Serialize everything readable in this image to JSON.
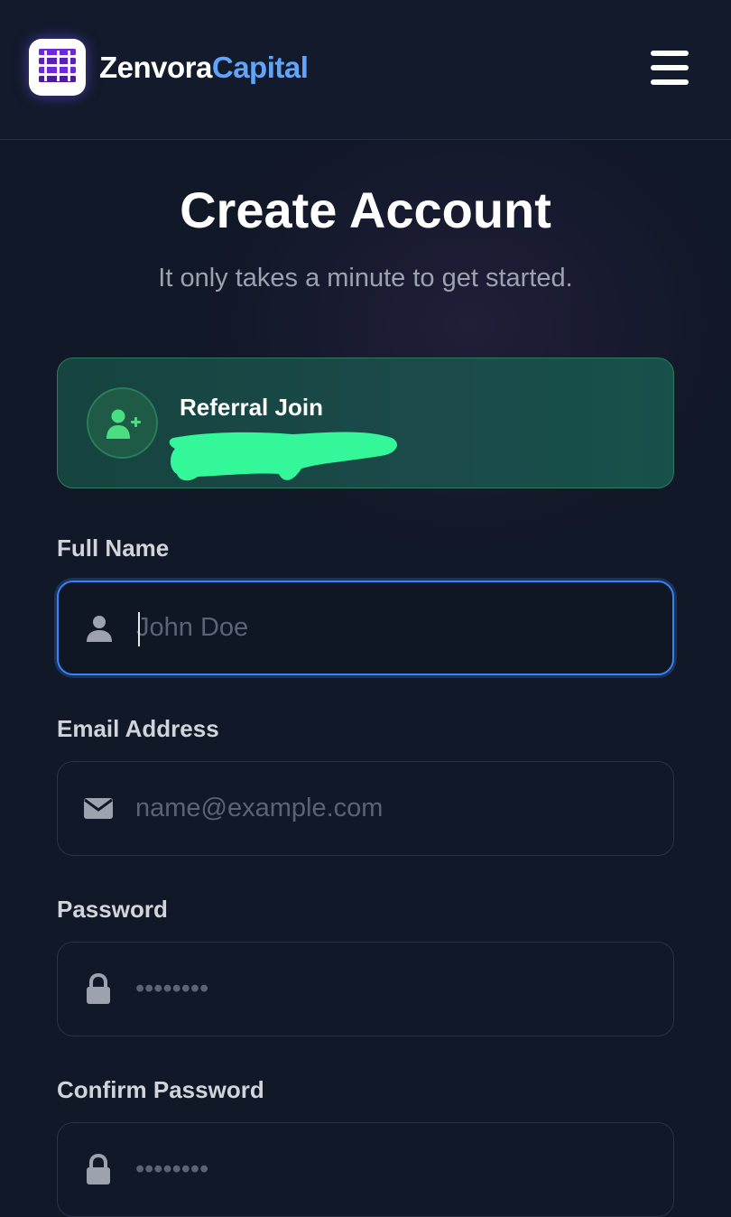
{
  "header": {
    "brand_part1": "Zenvora",
    "brand_part2": "Capital",
    "logo_icon": "logo-icon",
    "menu_icon": "hamburger-menu-icon",
    "accent_color": "#60a5fa"
  },
  "main": {
    "title": "Create Account",
    "subtitle": "It only takes a minute to get started."
  },
  "referral": {
    "icon": "user-plus-icon",
    "title": "Referral Join",
    "code": "",
    "highlight_color": "#34f79a"
  },
  "form": {
    "full_name": {
      "label": "Full Name",
      "placeholder": "John Doe",
      "icon": "user-icon"
    },
    "email": {
      "label": "Email Address",
      "placeholder": "name@example.com",
      "icon": "envelope-icon"
    },
    "password": {
      "label": "Password",
      "placeholder": "••••••••",
      "icon": "lock-icon"
    },
    "confirm_password": {
      "label": "Confirm Password",
      "placeholder": "••••••••",
      "icon": "lock-icon"
    }
  }
}
